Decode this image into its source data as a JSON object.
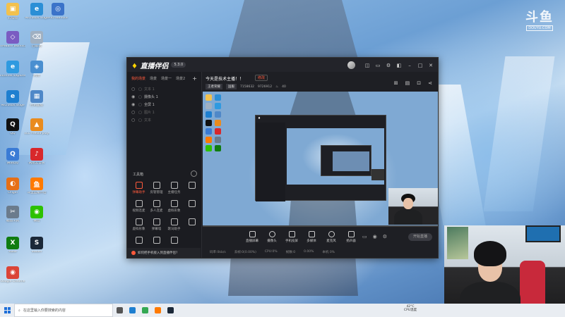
{
  "desktop": {
    "icons": [
      {
        "label": "此电脑",
        "color": "#f2c14e",
        "glyph": "▣"
      },
      {
        "label": "Microsoft Edge",
        "color": "#2b8fd6",
        "glyph": "e"
      },
      {
        "label": "PS5 Remote",
        "color": "#3b73c9",
        "glyph": "◎"
      },
      {
        "label": "VMware Workstation",
        "color": "#7a5cc2",
        "glyph": "◇"
      },
      {
        "label": "回收站",
        "color": "#9fb0c2",
        "glyph": "⌫"
      },
      {
        "label": "Internet Explorer",
        "color": "#2f9ae0",
        "glyph": "e"
      },
      {
        "label": "网络",
        "color": "#4a8fd0",
        "glyph": "◈"
      },
      {
        "label": "Microsoft Edge",
        "color": "#1e7fd0",
        "glyph": "e"
      },
      {
        "label": "控制面板",
        "color": "#4f88c8",
        "glyph": "▦"
      },
      {
        "label": "QQ",
        "color": "#111111",
        "glyph": "Q"
      },
      {
        "label": "VLC media player",
        "color": "#e98b1e",
        "glyph": "▲"
      },
      {
        "label": "腾讯QQ",
        "color": "#3a7bd5",
        "glyph": "Q"
      },
      {
        "label": "网易云音乐",
        "color": "#d8282c",
        "glyph": "♪"
      },
      {
        "label": "Origin",
        "color": "#e66f17",
        "glyph": "◐"
      },
      {
        "label": "斗鱼直播伴侣",
        "color": "#ff7a00",
        "glyph": "鱼"
      },
      {
        "label": "截图工具",
        "color": "#6b7b8c",
        "glyph": "✂"
      },
      {
        "label": "微信",
        "color": "#2dc100",
        "glyph": "◉"
      },
      {
        "label": "Xbox",
        "color": "#107c10",
        "glyph": "X"
      },
      {
        "label": "Steam",
        "color": "#1b2838",
        "glyph": "S"
      },
      {
        "label": "Google Chrome",
        "color": "#db4437",
        "glyph": "◉"
      }
    ]
  },
  "douyu_logo": {
    "big": "斗鱼",
    "small": "DOUYU.COM"
  },
  "app": {
    "logo_text": "直播伴侣",
    "version": "5.3.0",
    "titlebar_icons": [
      "avatar",
      "gift-icon",
      "message-icon",
      "settings-icon",
      "skin-icon",
      "minimize-icon",
      "maximize-icon",
      "close-icon"
    ],
    "scene_tabs": [
      "我的场景",
      "场景",
      "场景一",
      "场景2"
    ],
    "sources": [
      {
        "label": "文本 1",
        "visible": false
      },
      {
        "label": "摄像头 1",
        "visible": true
      },
      {
        "label": "全屏 1",
        "visible": true
      },
      {
        "label": "图片 1",
        "visible": false
      },
      {
        "label": "文本",
        "visible": false
      }
    ],
    "tools_title": "工具箱",
    "tools": [
      {
        "label": "弹幕助手",
        "highlight": true
      },
      {
        "label": "房管管理",
        "highlight": false
      },
      {
        "label": "主播任务",
        "highlight": false
      },
      {
        "label": "",
        "highlight": false
      },
      {
        "label": "视频连麦",
        "highlight": false
      },
      {
        "label": "多人连麦",
        "highlight": false
      },
      {
        "label": "虚拟形象",
        "highlight": false
      },
      {
        "label": "",
        "highlight": false
      },
      {
        "label": "虚拟形象",
        "highlight": false
      },
      {
        "label": "弹幕墙",
        "highlight": false
      },
      {
        "label": "歌词助手",
        "highlight": false
      },
      {
        "label": "",
        "highlight": false
      },
      {
        "label": "",
        "highlight": false
      },
      {
        "label": "",
        "highlight": false
      },
      {
        "label": "",
        "highlight": false
      }
    ],
    "footer_text": "如何把手机接入到直播伴侣?",
    "stream": {
      "title": "今天是技术主播！！",
      "edit": "修改",
      "category": "王者荣耀",
      "tag": "国服",
      "room": "7158632",
      "fans": "9726912",
      "hot": "40"
    },
    "header_tools": [
      "gift-icon",
      "chart-icon",
      "grid-icon",
      "share-icon"
    ],
    "controls": [
      {
        "label": "直播屏幕",
        "round": false
      },
      {
        "label": "摄像头",
        "round": true
      },
      {
        "label": "手机投屏",
        "round": false
      },
      {
        "label": "多媒体",
        "round": false
      },
      {
        "label": "麦克风",
        "round": true
      },
      {
        "label": "扬声器",
        "round": false
      }
    ],
    "start_button": "开始直播",
    "perf": [
      "码率:0kb/s",
      "丢帧:0(0.00%)",
      "CPU:0%",
      "帧数:0",
      "0.00%",
      "本机 0%"
    ]
  },
  "taskbar": {
    "search_placeholder": "在这里输入你要搜索的内容",
    "apps": [
      {
        "name": "task-view",
        "color": "#555555"
      },
      {
        "name": "edge",
        "color": "#1e7fd0"
      },
      {
        "name": "chrome",
        "color": "#34a853"
      },
      {
        "name": "douyu",
        "color": "#ff7a00"
      },
      {
        "name": "steam",
        "color": "#1b2838"
      }
    ],
    "temp_value": "42°C",
    "temp_label": "CPU温度"
  }
}
